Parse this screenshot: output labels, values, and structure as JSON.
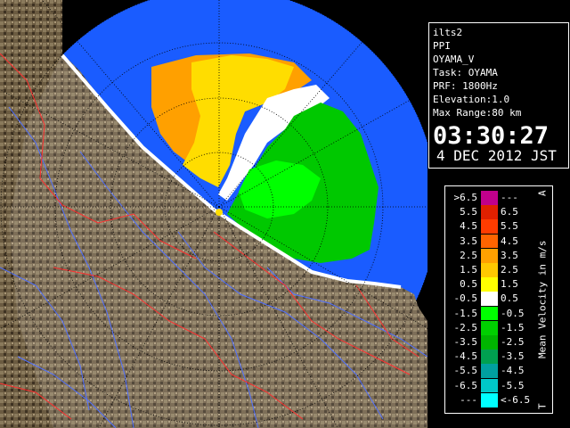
{
  "info_panel": {
    "lines": [
      "ilts2",
      "PPI",
      "OYAMA_V",
      "Task: OYAMA",
      "PRF: 1800Hz",
      "Elevation:1.0",
      "Max Range:80 km"
    ],
    "time": "03:30:27",
    "date": "4 DEC 2012 JST"
  },
  "legend": {
    "axis_label": "Mean Velocity in m/s",
    "corner_top": "A",
    "corner_bottom": "T",
    "rows": [
      {
        "lo": ">6.5",
        "hi": "---",
        "color": "#c0008c"
      },
      {
        "lo": "5.5",
        "hi": "6.5",
        "color": "#e02000"
      },
      {
        "lo": "4.5",
        "hi": "5.5",
        "color": "#ff3c00"
      },
      {
        "lo": "3.5",
        "hi": "4.5",
        "color": "#ff6400"
      },
      {
        "lo": "2.5",
        "hi": "3.5",
        "color": "#ffa000"
      },
      {
        "lo": "1.5",
        "hi": "2.5",
        "color": "#ffc800"
      },
      {
        "lo": "0.5",
        "hi": "1.5",
        "color": "#ffff00"
      },
      {
        "lo": "-0.5",
        "hi": "0.5",
        "color": "#ffffff"
      },
      {
        "lo": "-1.5",
        "hi": "-0.5",
        "color": "#00ff00"
      },
      {
        "lo": "-2.5",
        "hi": "-1.5",
        "color": "#00d000"
      },
      {
        "lo": "-3.5",
        "hi": "-2.5",
        "color": "#00b400"
      },
      {
        "lo": "-4.5",
        "hi": "-3.5",
        "color": "#00a050"
      },
      {
        "lo": "-5.5",
        "hi": "-4.5",
        "color": "#00a0a0"
      },
      {
        "lo": "-6.5",
        "hi": "-5.5",
        "color": "#00c8c8"
      },
      {
        "lo": "---",
        "hi": "<-6.5",
        "color": "#00ffff"
      }
    ]
  },
  "colors": {
    "range_bg": "#1a5cff",
    "terrain": "#6a5a40",
    "grid": "#000000",
    "rivers": "#5070ff",
    "boundaries": "#ff3030"
  }
}
